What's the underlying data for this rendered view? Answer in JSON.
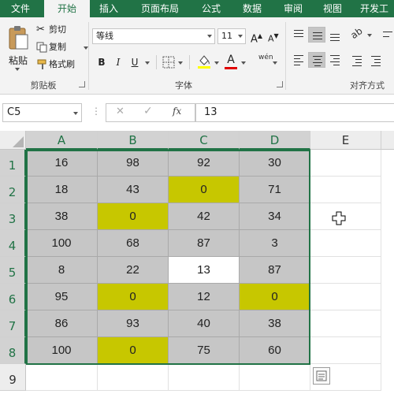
{
  "ribbon": {
    "tabs": [
      "文件",
      "开始",
      "插入",
      "页面布局",
      "公式",
      "数据",
      "审阅",
      "视图",
      "开发工"
    ],
    "active_tab": "开始",
    "clipboard": {
      "paste_label": "粘贴",
      "cut_label": "剪切",
      "copy_label": "复制",
      "format_painter_label": "格式刷",
      "group_label": "剪贴板"
    },
    "font": {
      "font_name": "等线",
      "font_size": "11",
      "grow_label": "A",
      "shrink_label": "A",
      "bold_label": "B",
      "italic_label": "I",
      "underline_label": "U",
      "font_color_label": "A",
      "phonetic_label": "wén",
      "group_label": "字体"
    },
    "alignment": {
      "group_label": "对齐方式"
    }
  },
  "formula_bar": {
    "name_box": "C5",
    "cancel_symbol": "✕",
    "enter_symbol": "✓",
    "fx_label": "fx",
    "formula": "13"
  },
  "grid": {
    "columns": [
      "A",
      "B",
      "C",
      "D",
      "E"
    ],
    "rows": [
      "1",
      "2",
      "3",
      "4",
      "5",
      "6",
      "7",
      "8",
      "9"
    ],
    "cells": [
      [
        "16",
        "98",
        "92",
        "30"
      ],
      [
        "18",
        "43",
        "0",
        "71"
      ],
      [
        "38",
        "0",
        "42",
        "34"
      ],
      [
        "100",
        "68",
        "87",
        "3"
      ],
      [
        "8",
        "22",
        "13",
        "87"
      ],
      [
        "95",
        "0",
        "12",
        "0"
      ],
      [
        "86",
        "93",
        "40",
        "38"
      ],
      [
        "100",
        "0",
        "75",
        "60"
      ]
    ]
  },
  "colors": {
    "accent": "#217346",
    "selection_fill": "#c6c6c6",
    "highlight_fill": "#c7c700",
    "active_cell_fill": "#ffffff"
  }
}
